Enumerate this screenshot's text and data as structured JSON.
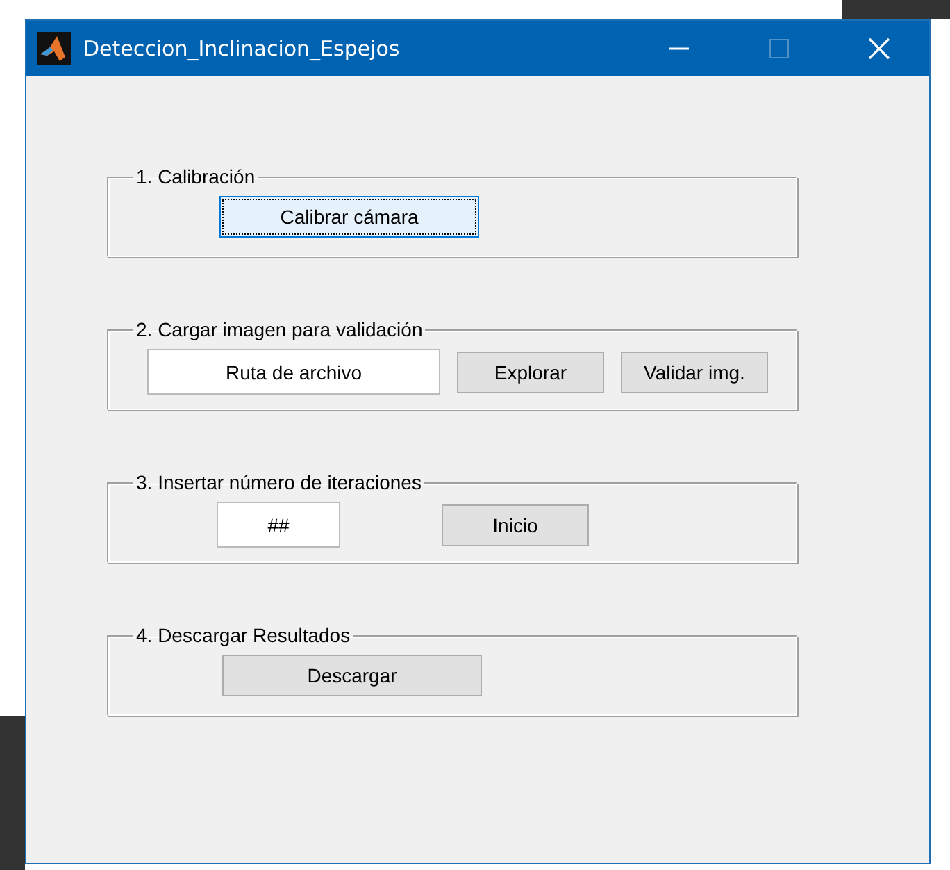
{
  "window": {
    "title": "Deteccion_Inclinacion_Espejos",
    "maximize_disabled": true
  },
  "panels": [
    {
      "title": "1. Calibración",
      "controls": [
        {
          "kind": "button",
          "label": "Calibrar cámara",
          "focused": true
        }
      ]
    },
    {
      "title": "2. Cargar imagen para validación",
      "controls": [
        {
          "kind": "field",
          "value": "Ruta de archivo"
        },
        {
          "kind": "button",
          "label": "Explorar",
          "focused": false
        },
        {
          "kind": "button",
          "label": "Validar img.",
          "focused": false
        }
      ]
    },
    {
      "title": "3. Insertar número de iteraciones",
      "controls": [
        {
          "kind": "field",
          "value": "##"
        },
        {
          "kind": "button",
          "label": "Inicio",
          "focused": false
        }
      ]
    },
    {
      "title": "4. Descargar Resultados",
      "controls": [
        {
          "kind": "button",
          "label": "Descargar",
          "focused": false
        }
      ]
    }
  ]
}
